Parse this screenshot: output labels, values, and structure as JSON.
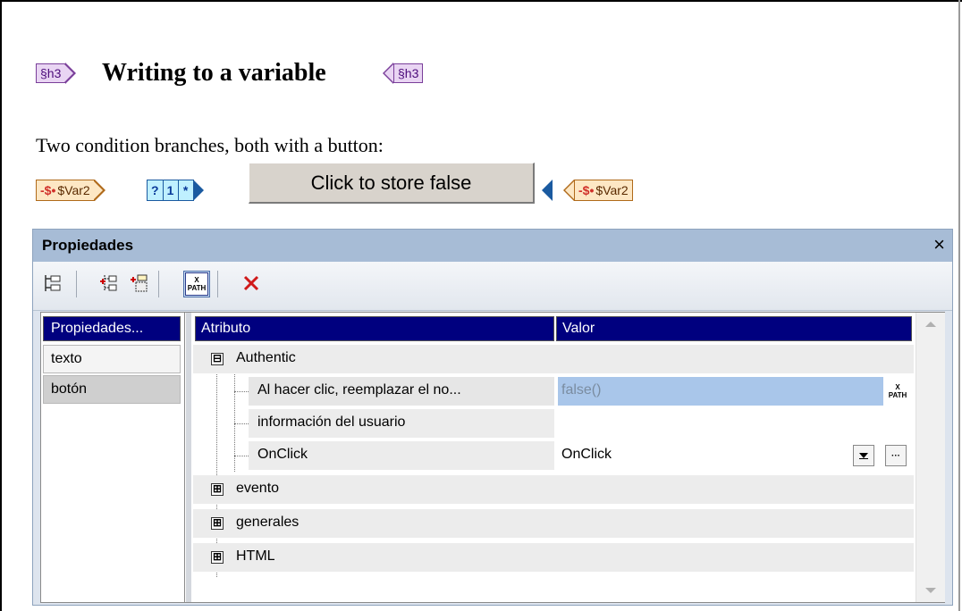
{
  "doc": {
    "h3_tag": "§h3",
    "heading": "Writing to a variable",
    "paragraph": "Two condition branches, both with a button:",
    "var_tag_open": "$Var2",
    "var_tag_close": "$Var2",
    "condition_cells": [
      "?",
      "1",
      "*"
    ],
    "button_label": "Click to store false"
  },
  "panel": {
    "title": "Propiedades",
    "close_glyph": "×",
    "toolbar_icons": [
      "add-tree-icon",
      "add-child-icon",
      "add-attribute-icon",
      "xpath-icon",
      "delete-icon"
    ],
    "xpath_icon_text": [
      "X",
      "PATH"
    ],
    "left_header": "Propiedades...",
    "left_items": [
      {
        "label": "texto"
      },
      {
        "label": "botón",
        "selected": true
      }
    ],
    "col_atributo": "Atributo",
    "col_valor": "Valor",
    "groups": [
      {
        "label": "Authentic",
        "expanded": true,
        "glyph": "⊟"
      },
      {
        "label": "evento",
        "expanded": false,
        "glyph": "⊞"
      },
      {
        "label": "generales",
        "expanded": false,
        "glyph": "⊞"
      },
      {
        "label": "HTML",
        "expanded": false,
        "glyph": "⊞"
      }
    ],
    "authentic_rows": [
      {
        "label": "Al hacer clic, reemplazar el no...",
        "value": "false()"
      },
      {
        "label": "información del usuario",
        "value": ""
      },
      {
        "label": "OnClick",
        "value": "OnClick"
      }
    ],
    "ellipsis": "···",
    "colors": {
      "title_bar": "#a7bcd6",
      "header_bg": "#00007f",
      "selected_row": "#a9c6ea"
    }
  }
}
